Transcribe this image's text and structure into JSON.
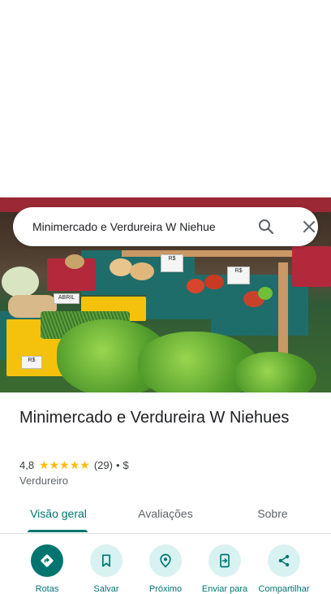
{
  "search": {
    "query": "Minimercado e Verdureira W Niehue"
  },
  "place": {
    "name": "Minimercado e Verdureira W Niehues",
    "rating": "4,8",
    "stars": "★★★★★",
    "review_count": "(29)",
    "separator": "•",
    "price": "$",
    "category": "Verdureiro"
  },
  "tabs": [
    {
      "label": "Visão geral"
    },
    {
      "label": "Avaliações"
    },
    {
      "label": "Sobre"
    }
  ],
  "actions": [
    {
      "label": "Rotas",
      "icon": "directions-icon"
    },
    {
      "label": "Salvar",
      "icon": "bookmark-icon"
    },
    {
      "label": "Próximo",
      "icon": "nearby-icon"
    },
    {
      "label": "Enviar para",
      "icon": "send-to-phone-icon"
    },
    {
      "label": "Compartilhar",
      "icon": "share-icon"
    }
  ],
  "photo_signs": [
    "ABRIL",
    "R$",
    "R$",
    "R$"
  ],
  "colors": {
    "accent": "#00756f",
    "accent_light": "#d8f2f1",
    "star": "#fbbc04"
  }
}
